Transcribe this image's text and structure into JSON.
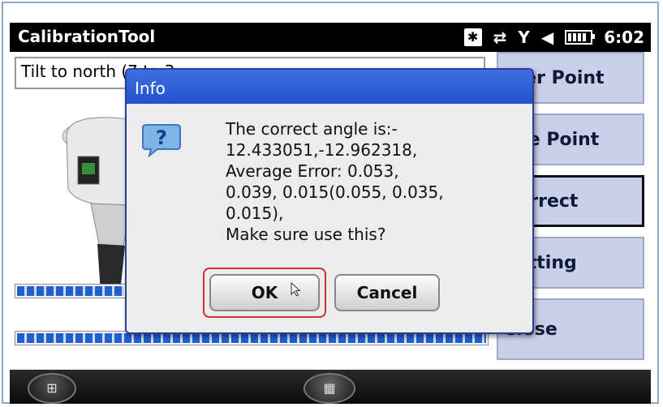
{
  "app": {
    "title": "CalibrationTool",
    "time": "6:02"
  },
  "status_icons": [
    "bluetooth-icon",
    "data-sync-icon",
    "signal-off-icon",
    "volume-icon",
    "battery-icon"
  ],
  "instruction": {
    "text": "Tilt to north (7 to 3"
  },
  "progress_bars": [
    {
      "fill_fraction": 0.18
    },
    {
      "fill_fraction": 1.0
    }
  ],
  "right_buttons": [
    {
      "label": "nter Point"
    },
    {
      "label": "line Point"
    },
    {
      "label": "Correct"
    },
    {
      "label": "Setting"
    },
    {
      "label": "Close"
    }
  ],
  "dialog": {
    "title": "Info",
    "message": "The correct angle is:-\n12.433051,-12.962318,\nAverage Error: 0.053,\n0.039, 0.015(0.055, 0.035,\n0.015),\nMake sure use this?",
    "ok_label": "OK",
    "cancel_label": "Cancel"
  },
  "colors": {
    "dialog_title": "#2452cf",
    "right_button": "#c9cfe8",
    "progress": "#1f5fd0",
    "ok_highlight": "#d03030"
  }
}
